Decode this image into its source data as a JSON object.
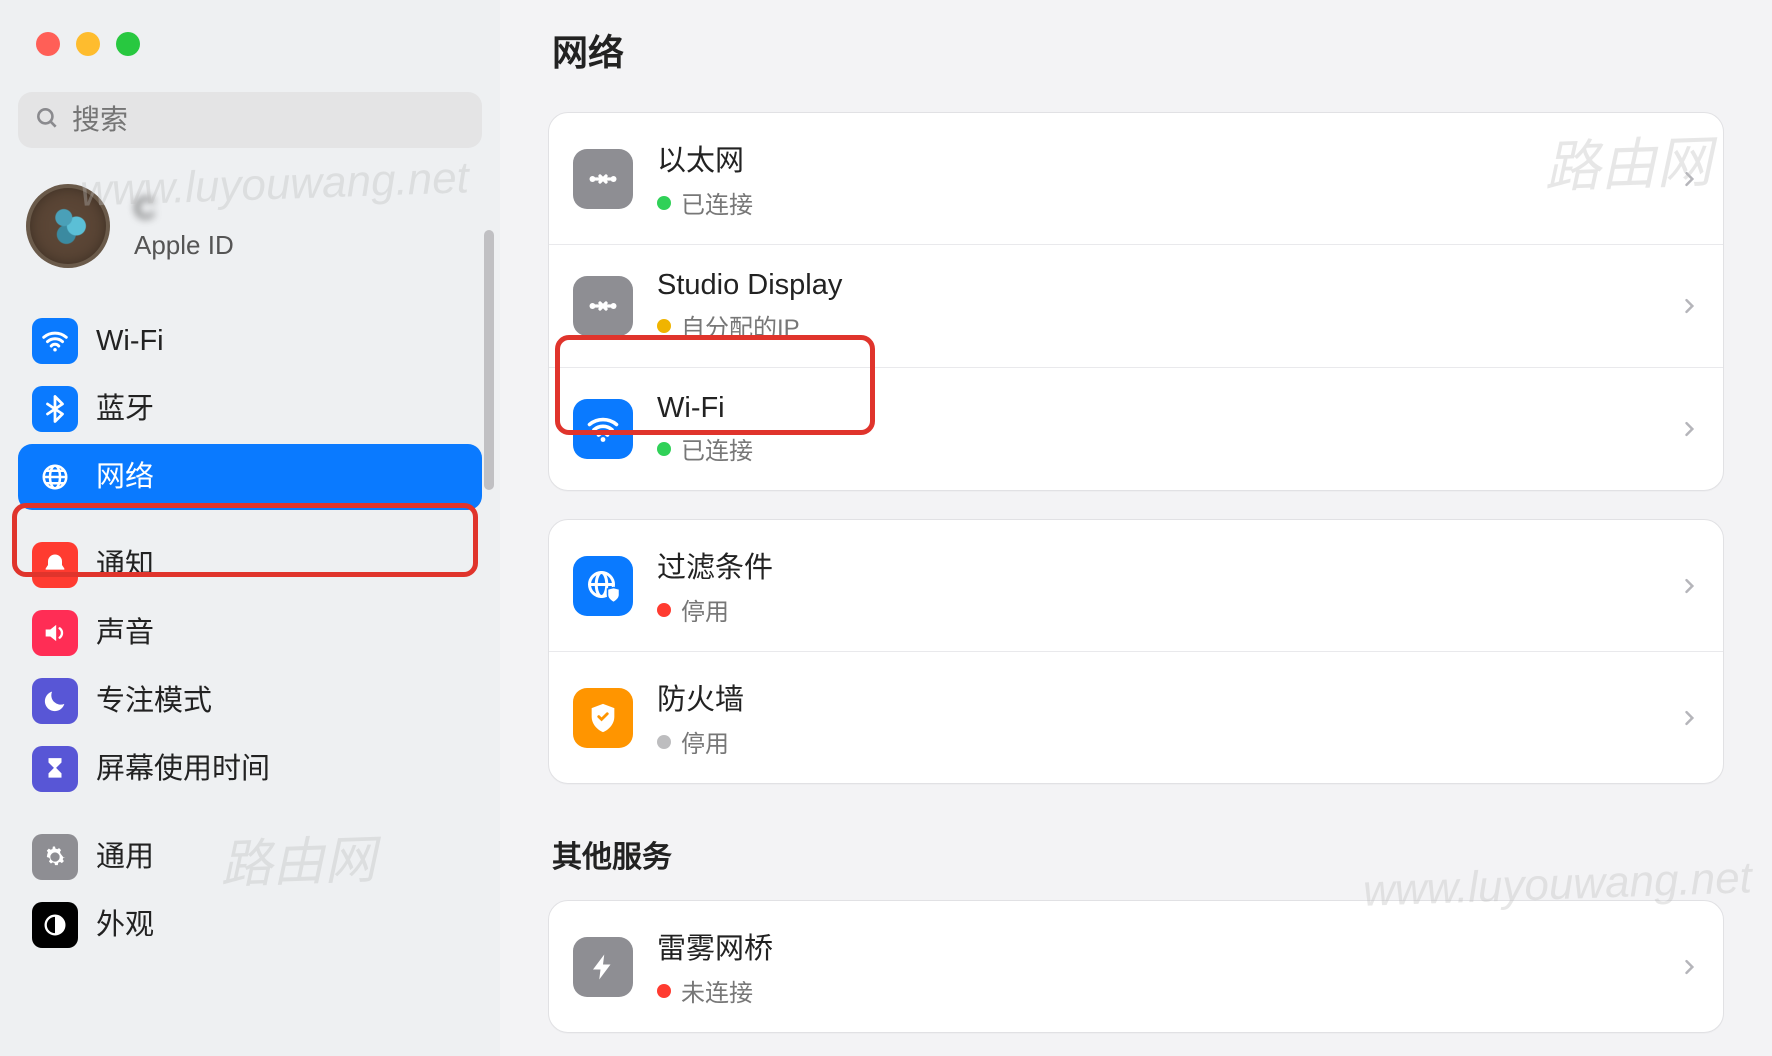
{
  "window": {
    "title": "网络"
  },
  "search": {
    "placeholder": "搜索"
  },
  "account": {
    "name_blurred": "C   ",
    "sub": "Apple ID"
  },
  "sidebar": {
    "items": [
      {
        "label": "Wi-Fi",
        "icon": "wifi",
        "bg": "#0a7aff"
      },
      {
        "label": "蓝牙",
        "icon": "bluetooth",
        "bg": "#0a7aff"
      },
      {
        "label": "网络",
        "icon": "globe",
        "bg": "#0a7aff",
        "selected": true
      },
      {
        "label": "通知",
        "icon": "bell",
        "bg": "#ff3b30"
      },
      {
        "label": "声音",
        "icon": "sound",
        "bg": "#ff2d55"
      },
      {
        "label": "专注模式",
        "icon": "moon",
        "bg": "#5856d6"
      },
      {
        "label": "屏幕使用时间",
        "icon": "hourglass",
        "bg": "#5856d6"
      },
      {
        "label": "通用",
        "icon": "gear",
        "bg": "#8e8e93"
      },
      {
        "label": "外观",
        "icon": "appearance",
        "bg": "#000000"
      }
    ]
  },
  "main": {
    "groups": [
      {
        "rows": [
          {
            "title": "以太网",
            "status": "已连接",
            "dot": "green",
            "icon": "ethernet",
            "bg": "#8e8e93"
          },
          {
            "title": "Studio Display",
            "status": "自分配的IP",
            "dot": "yellow",
            "icon": "ethernet",
            "bg": "#8e8e93"
          },
          {
            "title": "Wi-Fi",
            "status": "已连接",
            "dot": "green",
            "icon": "wifi",
            "bg": "#0a7aff",
            "highlight": true
          }
        ]
      },
      {
        "rows": [
          {
            "title": "过滤条件",
            "status": "停用",
            "dot": "red",
            "icon": "globe-shield",
            "bg": "#0a7aff"
          },
          {
            "title": "防火墙",
            "status": "停用",
            "dot": "grey",
            "icon": "firewall",
            "bg": "#ff9500"
          }
        ]
      }
    ],
    "other": {
      "heading": "其他服务",
      "rows": [
        {
          "title": "雷雾网桥",
          "status": "未连接",
          "dot": "red",
          "icon": "bolt",
          "bg": "#8e8e93"
        }
      ]
    }
  },
  "watermarks": [
    "www.luyouwang.net",
    "路由网",
    "www.luyouwang.net",
    "路由网"
  ]
}
